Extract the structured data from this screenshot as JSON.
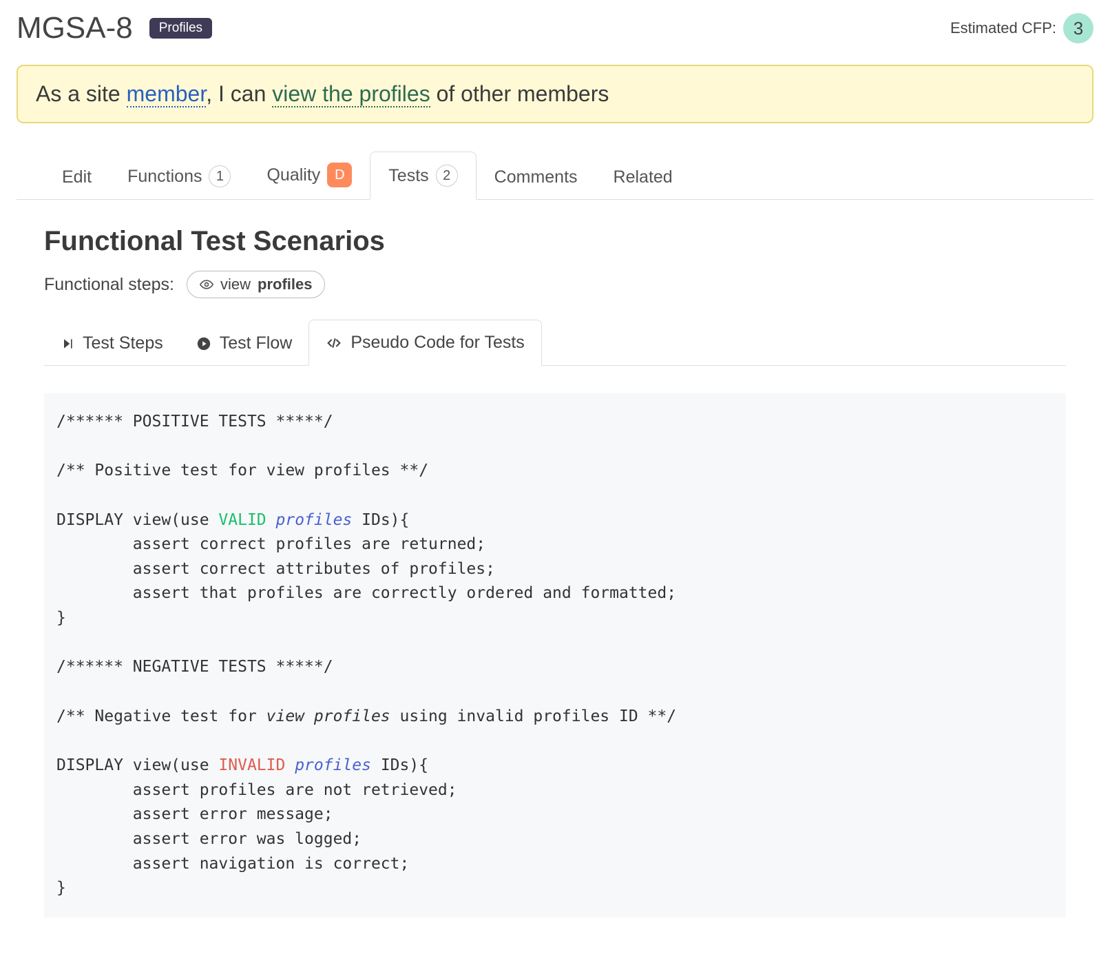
{
  "header": {
    "ticket_id": "MGSA-8",
    "tag": "Profiles",
    "cfp_label": "Estimated CFP:",
    "cfp_value": "3"
  },
  "story": {
    "prefix": "As a site ",
    "member": "member",
    "mid": ", I can ",
    "action": "view the profiles",
    "suffix": " of other members"
  },
  "tabs": {
    "edit": "Edit",
    "functions": "Functions",
    "functions_count": "1",
    "quality": "Quality",
    "quality_grade": "D",
    "tests": "Tests",
    "tests_count": "2",
    "comments": "Comments",
    "related": "Related"
  },
  "section": {
    "title": "Functional Test Scenarios",
    "steps_label": "Functional steps:",
    "step_verb": "view",
    "step_noun": "profiles"
  },
  "subtabs": {
    "steps": "Test Steps",
    "flow": "Test Flow",
    "pseudo": "Pseudo Code for Tests"
  },
  "code": {
    "pos_header": "/****** POSITIVE TESTS *****/",
    "pos_comment": "/** Positive test for view profiles **/",
    "disp1_a": "DISPLAY view(use ",
    "valid": "VALID",
    "profiles_i": "profiles",
    "ids_close": " IDs){",
    "pos_a1": "        assert correct profiles are returned;",
    "pos_a2": "        assert correct attributes of profiles;",
    "pos_a3": "        assert that profiles are correctly ordered and formatted;",
    "brace": "}",
    "neg_header": "/****** NEGATIVE TESTS *****/",
    "neg_comment_a": "/** Negative test for ",
    "neg_comment_i": "view profiles",
    "neg_comment_b": " using invalid profiles ID **/",
    "disp2_a": "DISPLAY view(use ",
    "invalid": "INVALID",
    "neg_a1": "        assert profiles are not retrieved;",
    "neg_a2": "        assert error message;",
    "neg_a3": "        assert error was logged;",
    "neg_a4": "        assert navigation is correct;"
  }
}
